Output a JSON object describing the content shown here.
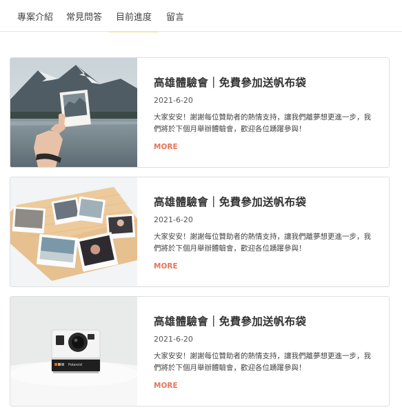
{
  "tabs": [
    {
      "label": "專案介紹"
    },
    {
      "label": "常見問答"
    },
    {
      "label": "目前進度"
    },
    {
      "label": "留言"
    }
  ],
  "active_tab": 2,
  "accent_colors": {
    "active_tab_underline": "#f3e7a8",
    "more_link": "#e8735a"
  },
  "posts": [
    {
      "image": "hand-holding-polaroid-photo",
      "title": "高雄體驗會｜免費參加送帆布袋",
      "date": "2021-6-20",
      "description": "大家安安！謝謝每位贊助者的熱情支持，讓我們離夢想更進一步，我們將於下個月舉辦體驗會，歡迎各位踴躍參與！",
      "more_label": "MORE"
    },
    {
      "image": "scattered-polaroid-photos",
      "title": "高雄體驗會｜免費參加送帆布袋",
      "date": "2021-6-20",
      "description": "大家安安！謝謝每位贊助者的熱情支持，讓我們離夢想更進一步，我們將於下個月舉辦體驗會，歡迎各位踴躍參與！",
      "more_label": "MORE"
    },
    {
      "image": "instant-camera-on-table",
      "title": "高雄體驗會｜免費參加送帆布袋",
      "date": "2021-6-20",
      "description": "大家安安！謝謝每位贊助者的熱情支持，讓我們離夢想更進一步，我們將於下個月舉辦體驗會，歡迎各位踴躍參與！",
      "more_label": "MORE"
    }
  ],
  "camera_brand": "Polaroid"
}
